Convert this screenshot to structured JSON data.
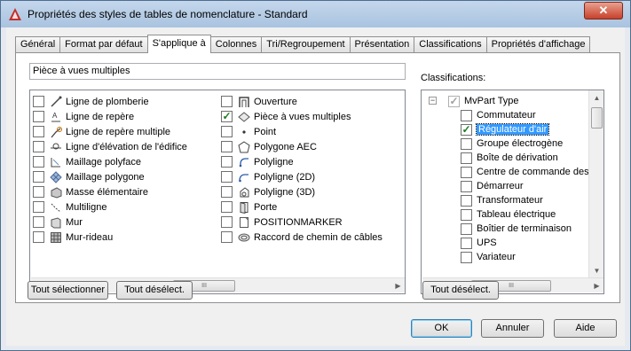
{
  "window": {
    "title": "Propriétés des styles de tables de nomenclature - Standard",
    "close_label": "✕"
  },
  "tabs": [
    {
      "label": "Général"
    },
    {
      "label": "Format par défaut"
    },
    {
      "label": "S'applique à",
      "active": true
    },
    {
      "label": "Colonnes"
    },
    {
      "label": "Tri/Regroupement"
    },
    {
      "label": "Présentation"
    },
    {
      "label": "Classifications"
    },
    {
      "label": "Propriétés d'affichage"
    }
  ],
  "applies_to": {
    "name_value": "Pièce à vues multiples",
    "left_items": [
      {
        "label": "Ligne de plomberie",
        "checked": false,
        "icon": "plumbing-line-icon"
      },
      {
        "label": "Ligne de repère",
        "checked": false,
        "icon": "leader-icon"
      },
      {
        "label": "Ligne de repère multiple",
        "checked": false,
        "icon": "multileader-icon"
      },
      {
        "label": "Ligne d'élévation de l'édifice",
        "checked": false,
        "icon": "elevation-line-icon"
      },
      {
        "label": "Maillage polyface",
        "checked": false,
        "icon": "polyface-mesh-icon"
      },
      {
        "label": "Maillage polygone",
        "checked": false,
        "icon": "polygon-mesh-icon"
      },
      {
        "label": "Masse élémentaire",
        "checked": false,
        "icon": "mass-element-icon"
      },
      {
        "label": "Multiligne",
        "checked": false,
        "icon": "mline-icon"
      },
      {
        "label": "Mur",
        "checked": false,
        "icon": "wall-icon"
      },
      {
        "label": "Mur-rideau",
        "checked": false,
        "icon": "curtain-wall-icon"
      }
    ],
    "right_items": [
      {
        "label": "Ouverture",
        "checked": false,
        "icon": "opening-icon"
      },
      {
        "label": "Pièce à vues multiples",
        "checked": true,
        "icon": "multiview-block-icon"
      },
      {
        "label": "Point",
        "checked": false,
        "icon": "point-icon"
      },
      {
        "label": "Polygone AEC",
        "checked": false,
        "icon": "aec-polygon-icon"
      },
      {
        "label": "Polyligne",
        "checked": false,
        "icon": "polyline-icon"
      },
      {
        "label": "Polyligne (2D)",
        "checked": false,
        "icon": "polyline-2d-icon"
      },
      {
        "label": "Polyligne (3D)",
        "checked": false,
        "icon": "polyline-3d-icon"
      },
      {
        "label": "Porte",
        "checked": false,
        "icon": "door-icon"
      },
      {
        "label": "POSITIONMARKER",
        "checked": false,
        "icon": "position-marker-icon"
      },
      {
        "label": "Raccord de chemin de câbles",
        "checked": false,
        "icon": "cable-tray-fitting-icon"
      }
    ],
    "select_all_label": "Tout sélectionner",
    "deselect_label": "Tout désélect."
  },
  "classifications": {
    "label": "Classifications:",
    "root": "MvPart Type",
    "items": [
      {
        "label": "Commutateur",
        "checked": false
      },
      {
        "label": "Régulateur d'air",
        "checked": true,
        "selected": true
      },
      {
        "label": "Groupe électrogène",
        "checked": false
      },
      {
        "label": "Boîte de dérivation",
        "checked": false
      },
      {
        "label": "Centre de commande des mo",
        "checked": false
      },
      {
        "label": "Démarreur",
        "checked": false
      },
      {
        "label": "Transformateur",
        "checked": false
      },
      {
        "label": "Tableau électrique",
        "checked": false
      },
      {
        "label": "Boîtier de terminaison",
        "checked": false
      },
      {
        "label": "UPS",
        "checked": false
      },
      {
        "label": "Variateur",
        "checked": false
      }
    ],
    "deselect_label": "Tout désélect."
  },
  "footer": {
    "ok_label": "OK",
    "cancel_label": "Annuler",
    "help_label": "Aide"
  },
  "scroll": {
    "thumb_glyph": "III"
  },
  "colors": {
    "accent": "#3399ff",
    "title_bar": "#b8cfe8",
    "check": "#1f7a1f"
  }
}
